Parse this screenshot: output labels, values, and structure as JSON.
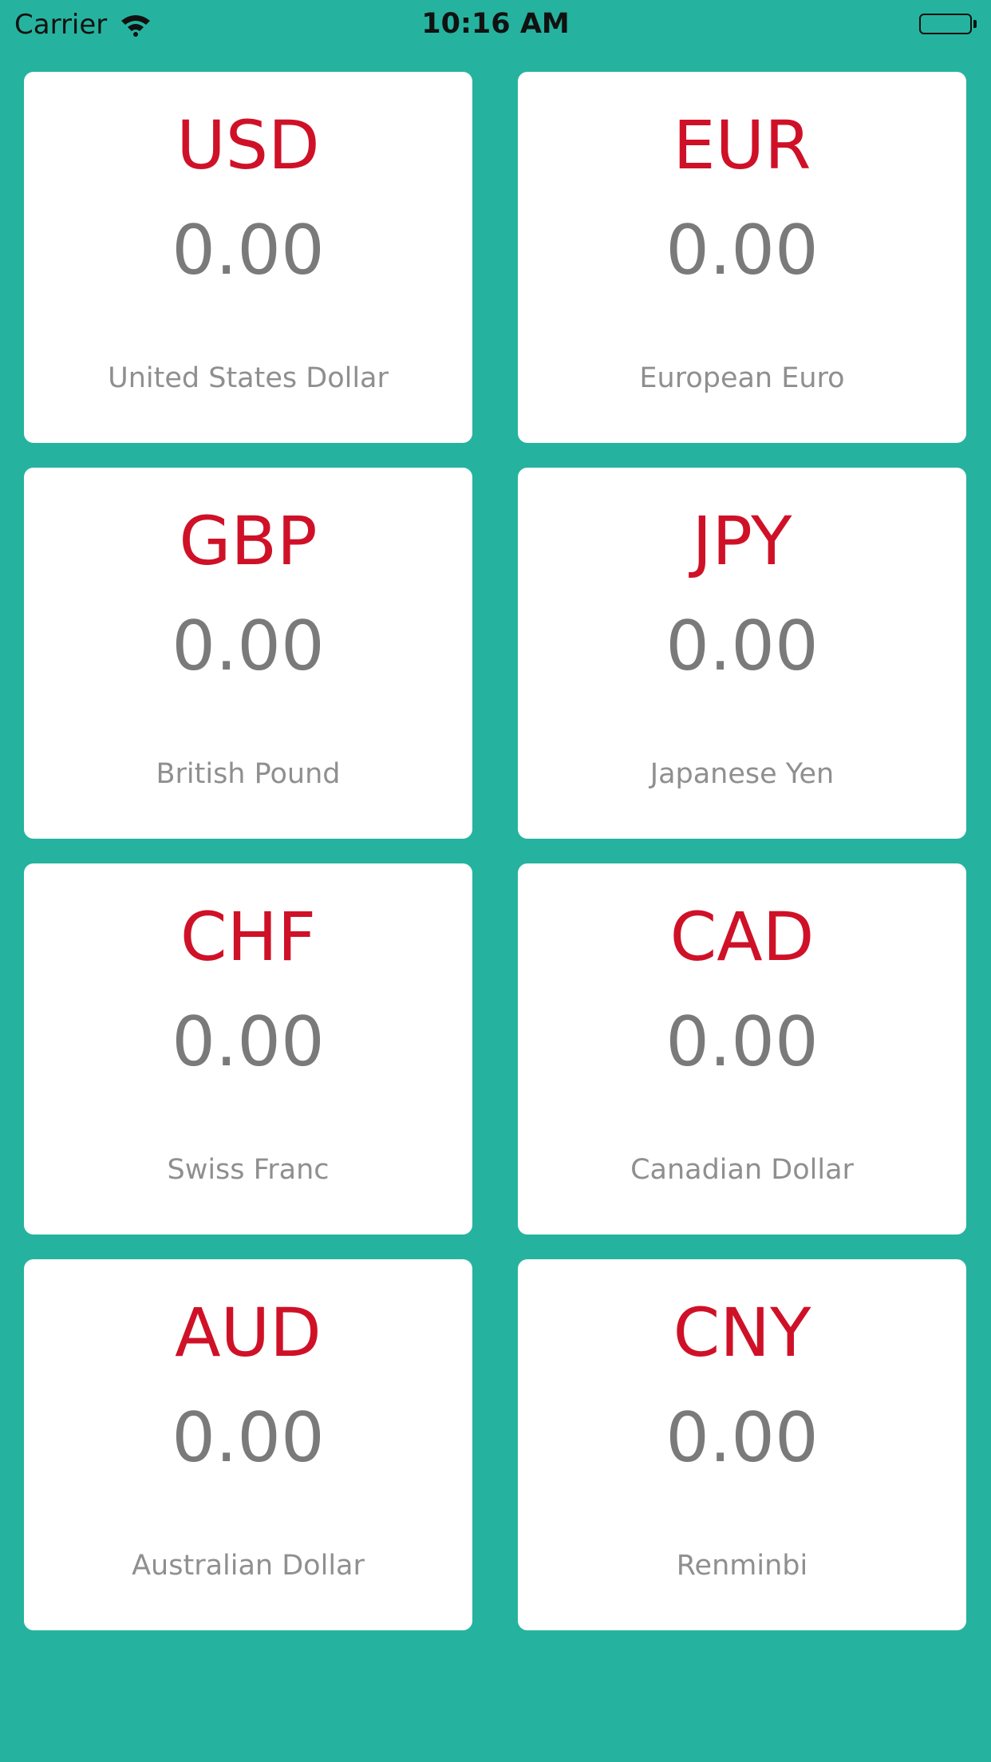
{
  "status_bar": {
    "carrier": "Carrier",
    "time": "10:16 AM",
    "wifi_icon": "wifi-icon",
    "battery_icon": "battery-icon"
  },
  "colors": {
    "background": "#25b39f",
    "card": "#ffffff",
    "code": "#cf1128",
    "amount": "#7a7a7a",
    "name": "#8f8f8f"
  },
  "currencies": [
    {
      "code": "USD",
      "amount": "0.00",
      "name": "United States Dollar"
    },
    {
      "code": "EUR",
      "amount": "0.00",
      "name": "European Euro"
    },
    {
      "code": "GBP",
      "amount": "0.00",
      "name": "British Pound"
    },
    {
      "code": "JPY",
      "amount": "0.00",
      "name": "Japanese Yen"
    },
    {
      "code": "CHF",
      "amount": "0.00",
      "name": "Swiss Franc"
    },
    {
      "code": "CAD",
      "amount": "0.00",
      "name": "Canadian Dollar"
    },
    {
      "code": "AUD",
      "amount": "0.00",
      "name": "Australian Dollar"
    },
    {
      "code": "CNY",
      "amount": "0.00",
      "name": "Renminbi"
    }
  ]
}
